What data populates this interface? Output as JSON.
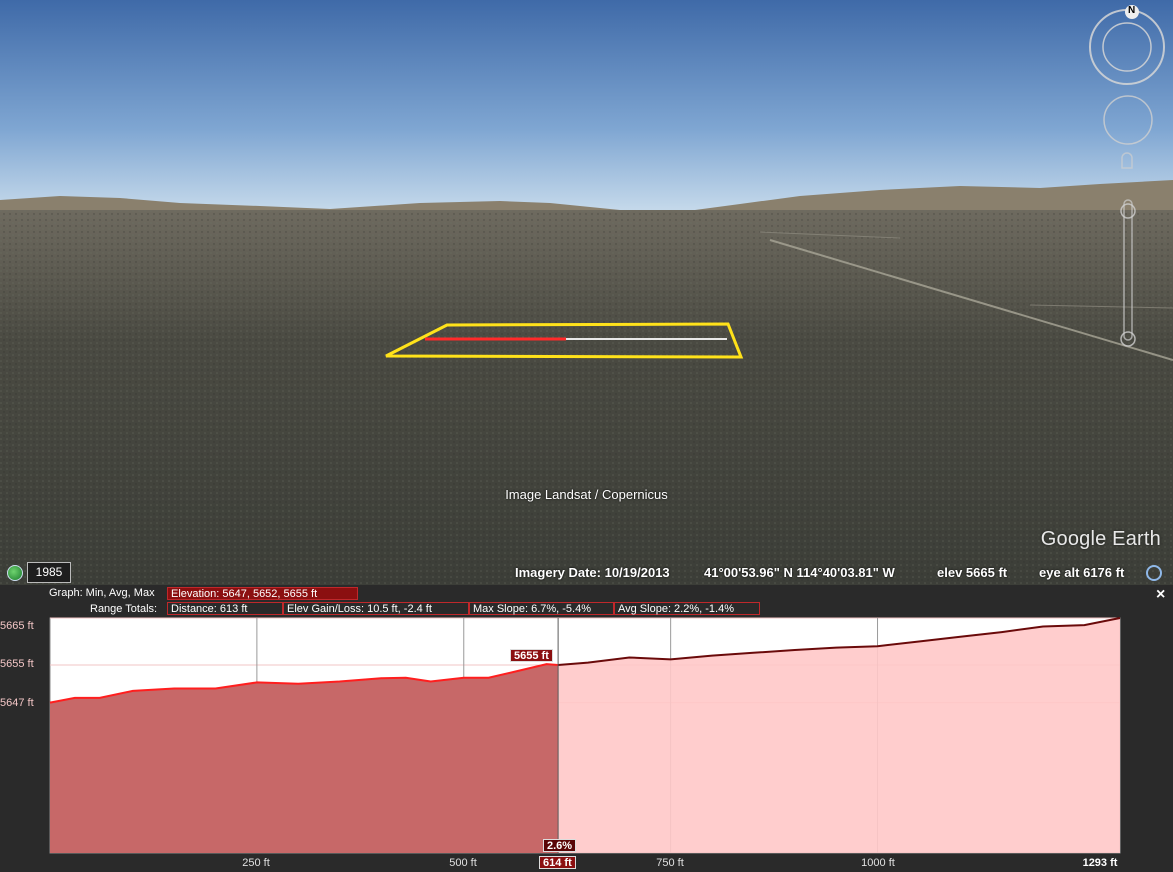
{
  "scene": {
    "attribution": "Image Landsat / Copernicus",
    "brand": "Google Earth",
    "compass_letter": "N"
  },
  "status": {
    "year": "1985",
    "imagery_date": "Imagery Date: 10/19/2013",
    "coords": "41°00'53.96\" N  114°40'03.81\" W",
    "elev": "elev  5665 ft",
    "eye_alt": "eye alt  6176 ft"
  },
  "profile": {
    "graph_label": "Graph: Min, Avg, Max",
    "elevation_box": "Elevation: 5647, 5652, 5655 ft",
    "range_label": "Range Totals:",
    "distance_box": "Distance: 613 ft",
    "gain_box": "Elev Gain/Loss: 10.5 ft, -2.4 ft",
    "max_slope_box": "Max Slope: 6.7%, -5.4%",
    "avg_slope_box": "Avg Slope: 2.2%, -1.4%",
    "close_label": "×",
    "cursor_elev_tag": "5655 ft",
    "cursor_slope_tag": "2.6%",
    "cursor_dist_tag": "614 ft"
  },
  "chart_data": {
    "type": "area",
    "ytick_labels": [
      "5665 ft",
      "5655 ft",
      "5647 ft"
    ],
    "ytick_values": [
      5665,
      5655,
      5647
    ],
    "xtick_labels": [
      "250 ft",
      "500 ft",
      "750 ft",
      "1000 ft",
      "1293 ft"
    ],
    "xtick_values": [
      250,
      500,
      750,
      1000,
      1293
    ],
    "xlim": [
      0,
      1293
    ],
    "ylim": [
      5615,
      5665
    ],
    "cursor_x": 614,
    "selected_range": [
      0,
      614
    ],
    "x": [
      0,
      30,
      60,
      100,
      150,
      200,
      250,
      300,
      350,
      400,
      430,
      460,
      500,
      530,
      560,
      600,
      614,
      650,
      700,
      750,
      800,
      850,
      900,
      950,
      1000,
      1050,
      1100,
      1150,
      1200,
      1250,
      1293
    ],
    "y": [
      5647,
      5648,
      5648,
      5649.5,
      5650,
      5650,
      5651.3,
      5651,
      5651.5,
      5652.2,
      5652.3,
      5651.5,
      5652.3,
      5652.3,
      5653.5,
      5655.2,
      5655,
      5655.5,
      5656.6,
      5656.2,
      5657,
      5657.6,
      5658.2,
      5658.7,
      5659,
      5660,
      5661,
      5662,
      5663.2,
      5663.5,
      5665
    ],
    "colors": {
      "selected_fill": "#c76868",
      "unselected_fill": "#ffc8c8",
      "selected_line": "#ff1e1e",
      "unselected_line": "#6a0a0a"
    }
  }
}
